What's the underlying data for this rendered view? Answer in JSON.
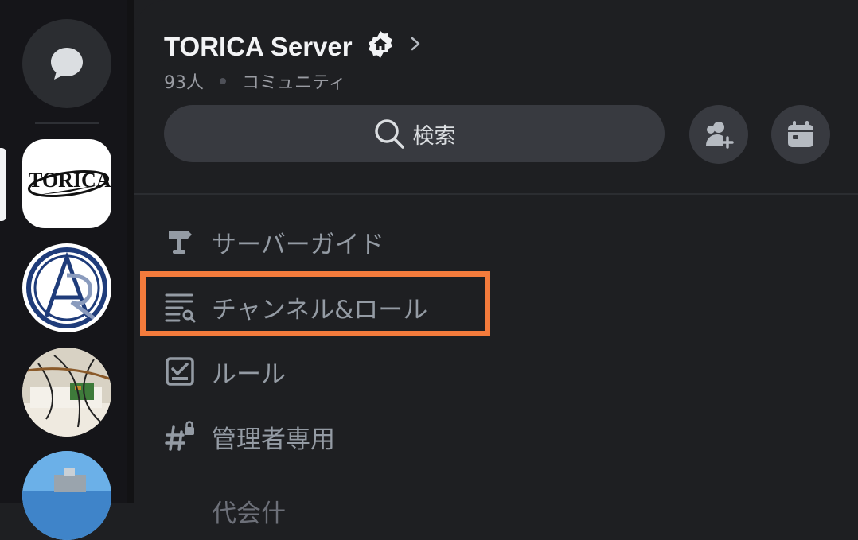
{
  "server": {
    "name": "TORICA Server",
    "members": "93人",
    "type": "コミュニティ"
  },
  "search": {
    "label": "検索"
  },
  "rail": {
    "servers": [
      {
        "name": "TORICA",
        "logo_text": "TORICA"
      },
      {
        "name": "AR logo"
      },
      {
        "name": "circuit photo"
      },
      {
        "name": "beach photo"
      }
    ]
  },
  "nav": {
    "items": [
      {
        "label": "サーバーガイド",
        "icon": "signpost-icon"
      },
      {
        "label": "チャンネル&ロール",
        "icon": "channel-list-search-icon",
        "highlighted": true
      },
      {
        "label": "ルール",
        "icon": "checkbox-icon"
      },
      {
        "label": "管理者専用",
        "icon": "locked-hash-icon"
      },
      {
        "label": "代会什",
        "icon": ""
      }
    ]
  },
  "colors": {
    "highlight": "#f47b3c",
    "background": "#1e1f22",
    "button": "#383a40"
  }
}
